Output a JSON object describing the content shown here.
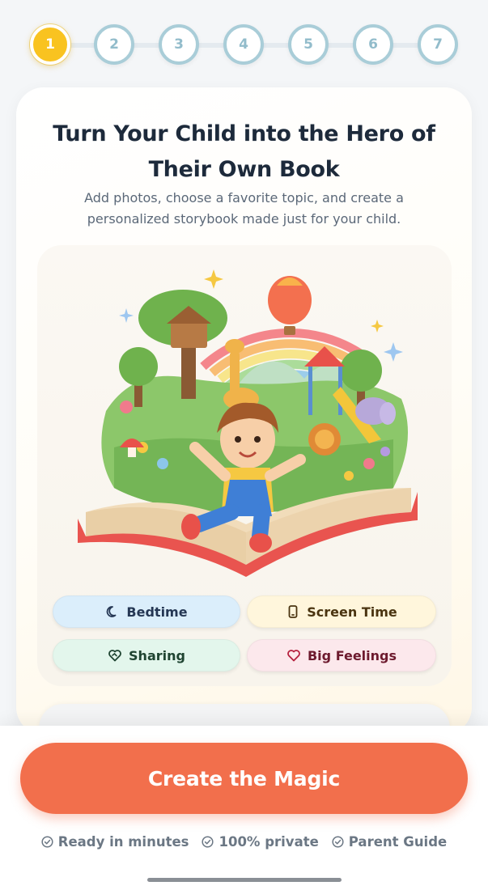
{
  "stepper": {
    "steps": [
      "1",
      "2",
      "3",
      "4",
      "5",
      "6",
      "7"
    ],
    "active_step": 1
  },
  "hero": {
    "title_line1": "Turn Your Child into the Hero of",
    "title_line2": "Their Own Book",
    "subtitle_line1": "Add photos, choose a favorite topic, and create a",
    "subtitle_line2": "personalized storybook made just for your child."
  },
  "topics": {
    "bedtime": {
      "label": "Bedtime",
      "icon": "moon-icon",
      "color": "#dbeefb"
    },
    "screen_time": {
      "label": "Screen Time",
      "icon": "phone-icon",
      "color": "#fff6dc"
    },
    "sharing": {
      "label": "Sharing",
      "icon": "heart-handshake-icon",
      "color": "#e3f6ec"
    },
    "big_feelings": {
      "label": "Big Feelings",
      "icon": "heart-icon",
      "color": "#fce8ec"
    }
  },
  "cta": {
    "label": "Create the Magic",
    "color": "#f26f4c"
  },
  "trust": {
    "items": [
      "Ready in minutes",
      "100% private",
      "Parent Guide"
    ]
  },
  "colors": {
    "active_step": "#f9c320",
    "inactive_step_border": "#a9cdd8",
    "title": "#1d2a3b"
  }
}
